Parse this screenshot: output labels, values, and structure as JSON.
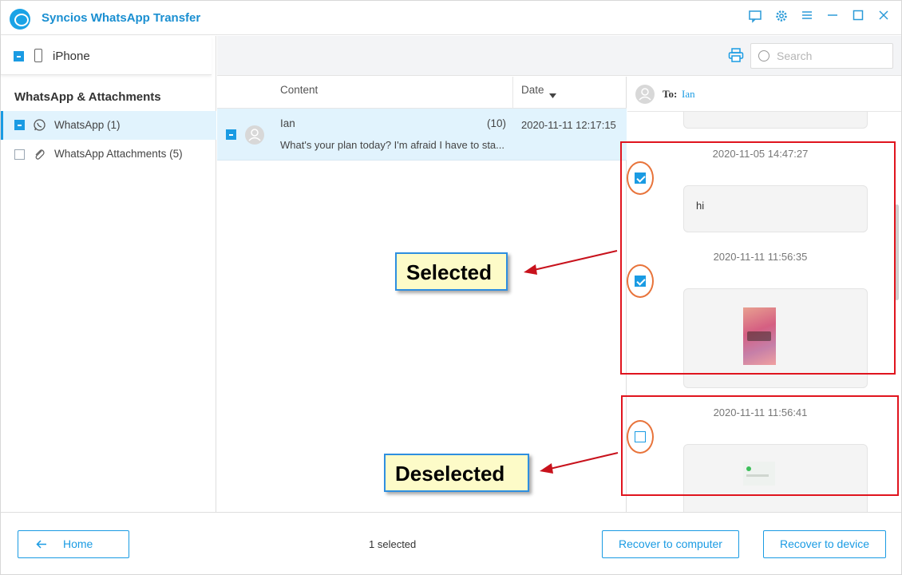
{
  "app": {
    "title": "Syncios WhatsApp Transfer"
  },
  "window_controls": [
    "feedback-icon",
    "settings-icon",
    "menu-icon",
    "minimize-icon",
    "maximize-icon",
    "close-icon"
  ],
  "sidebar": {
    "device": "iPhone",
    "section_title": "WhatsApp & Attachments",
    "items": [
      {
        "label": "WhatsApp (1)",
        "state": "partial"
      },
      {
        "label": "WhatsApp Attachments (5)",
        "state": "unchecked"
      }
    ]
  },
  "toolbar": {
    "search_placeholder": "Search"
  },
  "list": {
    "col_content": "Content",
    "col_date": "Date",
    "rows": [
      {
        "name": "Ian",
        "count": "(10)",
        "date": "2020-11-11 12:17:15",
        "preview": "What's your plan today? I'm afraid I have to sta..."
      }
    ]
  },
  "chat": {
    "to_label": "To:",
    "to_name": "Ian",
    "messages": [
      {
        "timestamp": "2020-11-05 14:47:27",
        "text": "hi",
        "selected": true
      },
      {
        "timestamp": "2020-11-11 11:56:35",
        "type": "image",
        "selected": true
      },
      {
        "timestamp": "2020-11-11 11:56:41",
        "type": "image",
        "selected": false
      }
    ]
  },
  "annotations": {
    "selected_label": "Selected",
    "deselected_label": "Deselected"
  },
  "footer": {
    "home_label": "Home",
    "selected_count": "1 selected",
    "recover_computer": "Recover to computer",
    "recover_device": "Recover to device"
  },
  "colors": {
    "accent": "#1a9be3",
    "highlight": "#e1f3fd",
    "annotation_red": "#e0141e",
    "callout_bg": "#fdfbc8"
  }
}
